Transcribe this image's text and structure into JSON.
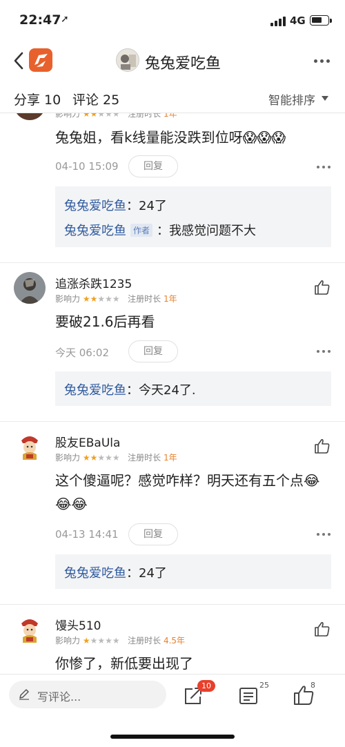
{
  "status_bar": {
    "time": "22:47",
    "network": "4G"
  },
  "nav": {
    "title": "兔兔爱吃鱼"
  },
  "tabs": {
    "share": "分享 10",
    "comment": "评论 25",
    "sort": "智能排序"
  },
  "comments": [
    {
      "username": "",
      "meta_influence": "影响力",
      "meta_reg": "注册时长",
      "meta_reg_value": "1年",
      "content": "兔兔姐，看k线量能没跌到位呀",
      "emoji": "😱😱😱",
      "time": "04-10 15:09",
      "reply_label": "回复",
      "replies": [
        {
          "user": "兔兔爱吃鱼",
          "author_tag": "",
          "text": "：24了"
        },
        {
          "user": "兔兔爱吃鱼",
          "author_tag": "作者",
          "text": "：我感觉问题不大"
        }
      ]
    },
    {
      "username": "追涨杀跌1235",
      "meta_influence": "影响力",
      "meta_reg": "注册时长",
      "meta_reg_value": "1年",
      "content": "要破21.6后再看",
      "time": "今天 06:02",
      "reply_label": "回复",
      "replies": [
        {
          "user": "兔兔爱吃鱼",
          "author_tag": "",
          "text": "：今天24了."
        }
      ]
    },
    {
      "username": "股友EBaUla",
      "meta_influence": "影响力",
      "meta_reg": "注册时长",
      "meta_reg_value": "1年",
      "content": "这个傻逼呢？感觉咋样？明天还有五个点",
      "emoji": "😂😂😂",
      "time": "04-13 14:41",
      "reply_label": "回复",
      "replies": [
        {
          "user": "兔兔爱吃鱼",
          "author_tag": "",
          "text": "：24了"
        }
      ]
    },
    {
      "username": "馒头510",
      "meta_influence": "影响力",
      "meta_reg": "注册时长",
      "meta_reg_value": "4.5年",
      "content": "你惨了，新低要出现了"
    }
  ],
  "bottom": {
    "placeholder": "写评论...",
    "share_count": "10",
    "comment_count": "25",
    "like_count": "8"
  },
  "colors": {
    "accent": "#e8612c",
    "reply_user": "#2f5a9e",
    "star": "#f0a020"
  }
}
